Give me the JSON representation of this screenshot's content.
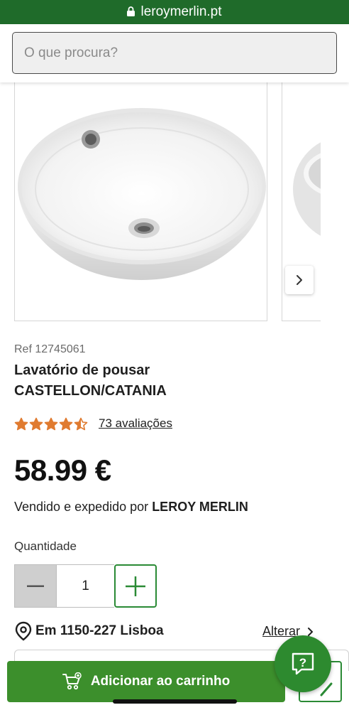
{
  "browser": {
    "url": "leroymerlin.pt"
  },
  "search": {
    "placeholder": "O que procura?"
  },
  "icons": {
    "lock": "lock-icon",
    "next": "chevron-right-icon",
    "star": "star-icon",
    "minus": "minus-icon",
    "plus": "plus-icon",
    "pin": "location-pin-icon",
    "cart": "cart-add-icon",
    "help": "help-chat-icon"
  },
  "product": {
    "ref": "Ref 12745061",
    "title_line1": "Lavatório de pousar",
    "title_line2": "CASTELLON/CATANIA",
    "rating": 4.5,
    "rating_max": 5,
    "reviews": "73 avaliações",
    "price": "58.99 €",
    "seller_prefix": "Vendido e expedido por",
    "seller_name": "LEROY MERLIN"
  },
  "quantity": {
    "label": "Quantidade",
    "value": "1"
  },
  "location": {
    "text": "Em 1150-227 Lisboa",
    "change_label": "Alterar"
  },
  "actions": {
    "add_to_cart": "Adicionar ao carrinho"
  },
  "colors": {
    "brand_green": "#3c8f2c",
    "dark_green": "#1f6b2a",
    "star_orange": "#e07b30"
  }
}
